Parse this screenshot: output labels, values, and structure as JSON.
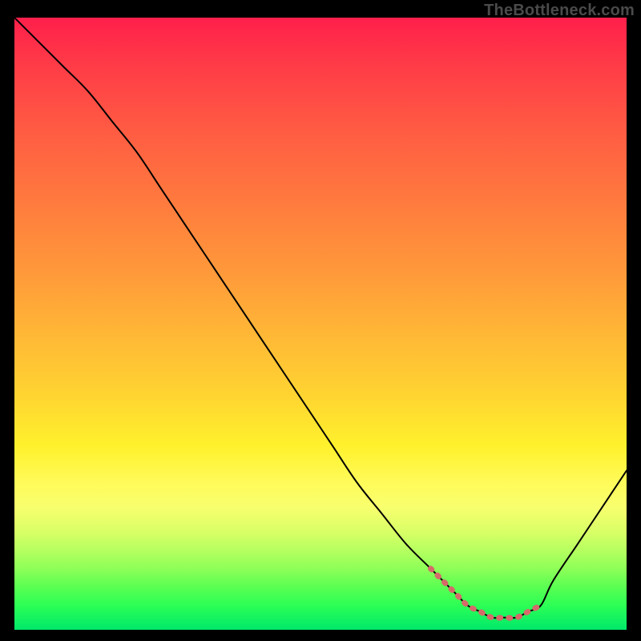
{
  "attribution": "TheBottleneck.com",
  "colors": {
    "background": "#000000",
    "curve_main": "#000000",
    "curve_highlight": "#d66a6a",
    "gradient_top": "#ff1f4b",
    "gradient_mid": "#fff12c",
    "gradient_bottom": "#00e86a"
  },
  "chart_data": {
    "type": "line",
    "title": "",
    "xlabel": "",
    "ylabel": "",
    "xlim": [
      0,
      100
    ],
    "ylim": [
      0,
      100
    ],
    "grid": false,
    "note": "Bottleneck-style curve: y = mismatch/bottleneck percentage (100=worst red, 0=optimal green). Valley marks the sweet-spot region. Highlighted segment (pink dashed) shows recommended range along the valley floor.",
    "series": [
      {
        "name": "bottleneck_curve",
        "x": [
          0,
          4,
          8,
          12,
          16,
          20,
          24,
          28,
          32,
          36,
          40,
          44,
          48,
          52,
          56,
          60,
          64,
          68,
          72,
          74,
          76,
          78,
          80,
          82,
          84,
          86,
          88,
          92,
          96,
          100
        ],
        "y": [
          100,
          96,
          92,
          88,
          83,
          78,
          72,
          66,
          60,
          54,
          48,
          42,
          36,
          30,
          24,
          19,
          14,
          10,
          6,
          4,
          3,
          2,
          2,
          2,
          3,
          4,
          8,
          14,
          20,
          26
        ]
      }
    ],
    "highlight_range": {
      "x_start": 68,
      "x_end": 86,
      "style": "dashed-pink"
    }
  }
}
